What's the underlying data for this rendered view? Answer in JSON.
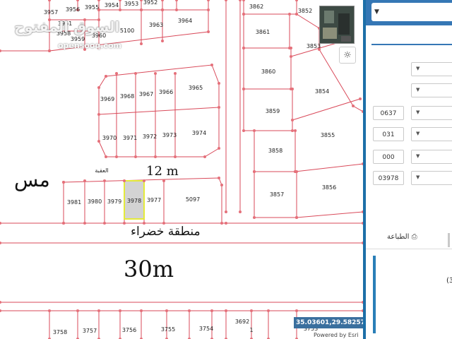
{
  "map": {
    "top_parcels": [
      "3957",
      "3956",
      "3955",
      "3954",
      "3953",
      "3952",
      "3958",
      "3959",
      "3960",
      "3961",
      "5100",
      "3963",
      "3964"
    ],
    "block_parcels": [
      "3965",
      "3966",
      "3967",
      "3968",
      "3969",
      "3970",
      "3971",
      "3972",
      "3973",
      "3974"
    ],
    "right_parcels": [
      "3862",
      "3852",
      "3861",
      "3853",
      "3860",
      "3854",
      "3859",
      "3855",
      "3858",
      "3857",
      "3856"
    ],
    "road_parcels": [
      "3981",
      "3980",
      "3979",
      "3978",
      "3977",
      "5097"
    ],
    "selected_parcel": "3978",
    "bottom_parcels": [
      "3758",
      "3757",
      "3756",
      "3755",
      "3754",
      "3692",
      "3753"
    ],
    "lower_right_label": "1",
    "frontage_label": "12 m",
    "road_label_small": "العقبة",
    "green_zone_label": "منطقة خضراء",
    "road_width_label": "30m",
    "left_partial_label": "مس",
    "coordinates": "35.03601,29.58257",
    "powered_by": "Powered by Esri",
    "watermark": "السوق المفتوح",
    "watermark_sub": "opensooq.com"
  },
  "colors": {
    "parcel_line": "#d94a5a",
    "vertex": "#e5707a",
    "selected_fill": "#d3d3d3",
    "selected_border": "#e4ea3a",
    "panel_accent": "#3577b5",
    "coord_bg": "#3a6f9e"
  },
  "icons": {
    "basemap": "satellite-thumbnail-icon",
    "locate": "sun-locate-icon",
    "print": "printer-icon",
    "caret": "caret-down-icon"
  },
  "panel": {
    "top_select_value": "",
    "fields": [
      {
        "value": ""
      },
      {
        "value": ""
      },
      {
        "value": "0637"
      },
      {
        "value": "031"
      },
      {
        "value": "000"
      },
      {
        "value": "03978"
      }
    ],
    "print_label": "الطباعة",
    "partial_text": "(3"
  }
}
